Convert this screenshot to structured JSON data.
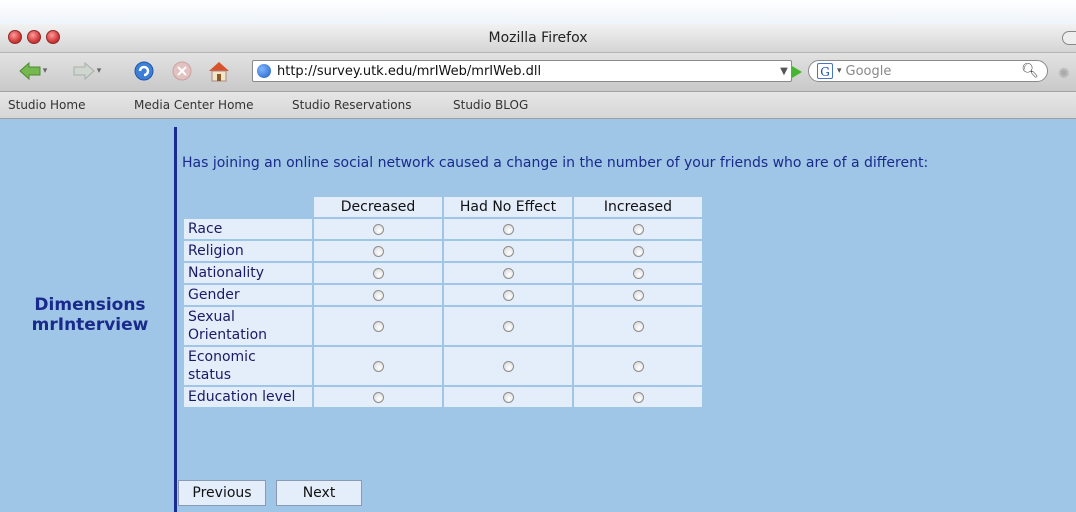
{
  "window": {
    "title": "Mozilla Firefox"
  },
  "toolbar": {
    "url": "http://survey.utk.edu/mrIWeb/mrIWeb.dll",
    "search_placeholder": "Google",
    "search_engine_letter": "G"
  },
  "bookmarks": [
    "Studio Home",
    "Media Center Home",
    "Studio Reservations",
    "Studio BLOG"
  ],
  "brand": {
    "line1": "Dimensions",
    "line2": "mrInterview"
  },
  "survey": {
    "question": "Has joining an online social network caused a change in the number of your friends who are of a different:",
    "columns": [
      "Decreased",
      "Had No Effect",
      "Increased"
    ],
    "rows": [
      {
        "l1": "Race",
        "l2": ""
      },
      {
        "l1": "Religion",
        "l2": ""
      },
      {
        "l1": "Nationality",
        "l2": ""
      },
      {
        "l1": "Gender",
        "l2": ""
      },
      {
        "l1": "Sexual",
        "l2": "Orientation"
      },
      {
        "l1": "Economic",
        "l2": "status"
      },
      {
        "l1": "Education level",
        "l2": ""
      }
    ]
  },
  "buttons": {
    "previous": "Previous",
    "next": "Next"
  },
  "colors": {
    "page_bg": "#9fc6e6",
    "brand_text": "#1a2a8c",
    "cell_bg": "#e3eefa"
  }
}
